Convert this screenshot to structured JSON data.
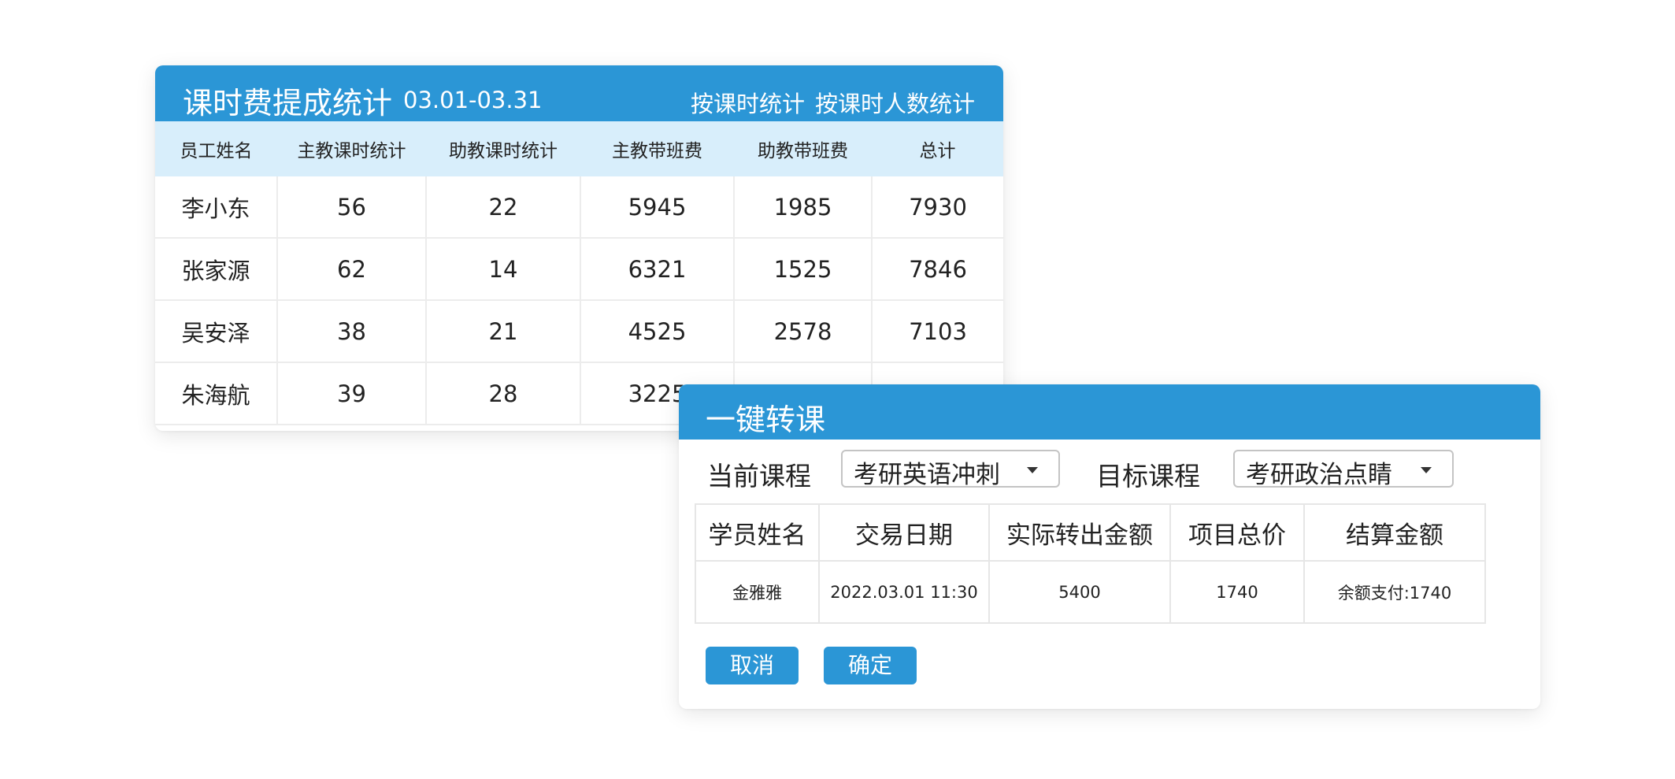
{
  "stats": {
    "title": "课时费提成统计",
    "date_range": "03.01-03.31",
    "mode_by_hours": "按课时统计",
    "mode_by_headcount": "按课时人数统计",
    "columns": [
      "员工姓名",
      "主教课时统计",
      "助教课时统计",
      "主教带班费",
      "助教带班费",
      "总计"
    ],
    "rows": [
      [
        "李小东",
        "56",
        "22",
        "5945",
        "1985",
        "7930"
      ],
      [
        "张家源",
        "62",
        "14",
        "6321",
        "1525",
        "7846"
      ],
      [
        "吴安泽",
        "38",
        "21",
        "4525",
        "2578",
        "7103"
      ],
      [
        "朱海航",
        "39",
        "28",
        "3225",
        "",
        ""
      ]
    ]
  },
  "transfer": {
    "title": "一键转课",
    "current_course_label": "当前课程",
    "current_course_value": "考研英语冲刺",
    "target_course_label": "目标课程",
    "target_course_value": "考研政治点睛",
    "columns": [
      "学员姓名",
      "交易日期",
      "实际转出金额",
      "项目总价",
      "结算金额"
    ],
    "rows": [
      [
        "金雅雅",
        "2022.03.01 11:30",
        "5400",
        "1740",
        "余额支付:1740"
      ]
    ],
    "cancel_label": "取消",
    "confirm_label": "确定"
  },
  "colors": {
    "header_blue": "#2b96d6",
    "table_header_bg": "#d8eefb"
  }
}
